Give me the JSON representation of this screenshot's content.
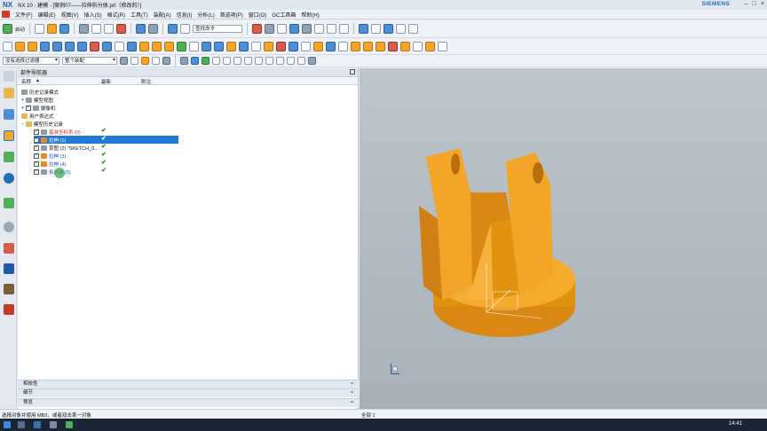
{
  "window": {
    "logo": "NX",
    "title": "NX 10 - 建模 - [案例07——拉伸拆分体.prt（修改的）]",
    "brand": "SIEMENS",
    "controls": [
      "–",
      "□",
      "×"
    ]
  },
  "menu": [
    "文件(F)",
    "编辑(E)",
    "视图(V)",
    "插入(S)",
    "格式(R)",
    "工具(T)",
    "装配(A)",
    "信息(I)",
    "分析(L)",
    "首选项(P)",
    "窗口(O)",
    "GC工具箱",
    "帮助(H)"
  ],
  "toolbar": {
    "start_label": "启动",
    "find_command_placeholder": "查找命令"
  },
  "selection_bar": {
    "filter": "没有选择过滤器",
    "scope": "整个装配"
  },
  "navigator": {
    "title": "部件导航器",
    "columns": {
      "name": "名称",
      "latest": "最新",
      "note": "附注"
    },
    "items": [
      {
        "label": "历史记录模式",
        "level": 0,
        "latest": ""
      },
      {
        "label": "模型视图",
        "level": 0,
        "latest": ""
      },
      {
        "label": "摄像机",
        "level": 0,
        "latest": ""
      },
      {
        "label": "用户表达式",
        "level": 0,
        "latest": ""
      },
      {
        "label": "模型历史记录",
        "level": 0,
        "latest": ""
      },
      {
        "label": "基准坐标系 (0)",
        "level": 1,
        "latest": "✔"
      },
      {
        "label": "拉伸 (1)",
        "level": 1,
        "latest": "✔"
      },
      {
        "label": "草图 (2) \"SKETCH_0...",
        "level": 1,
        "latest": "✔"
      },
      {
        "label": "拉伸 (3)",
        "level": 1,
        "latest": "✔"
      },
      {
        "label": "拉伸 (4)",
        "level": 1,
        "latest": "✔"
      },
      {
        "label": "拆分体 (5)",
        "level": 1,
        "latest": "✔"
      }
    ],
    "sections": [
      "相依性",
      "细节",
      "预览"
    ]
  },
  "status": {
    "prompt": "选择对象并使用 MB3，或者双击某一对象",
    "selection": "全部 1"
  },
  "taskbar": {
    "clock": "14:41"
  },
  "colors": {
    "accent": "#1f7ad6",
    "part": "#f2a526",
    "part_shadow": "#cf7f14"
  }
}
